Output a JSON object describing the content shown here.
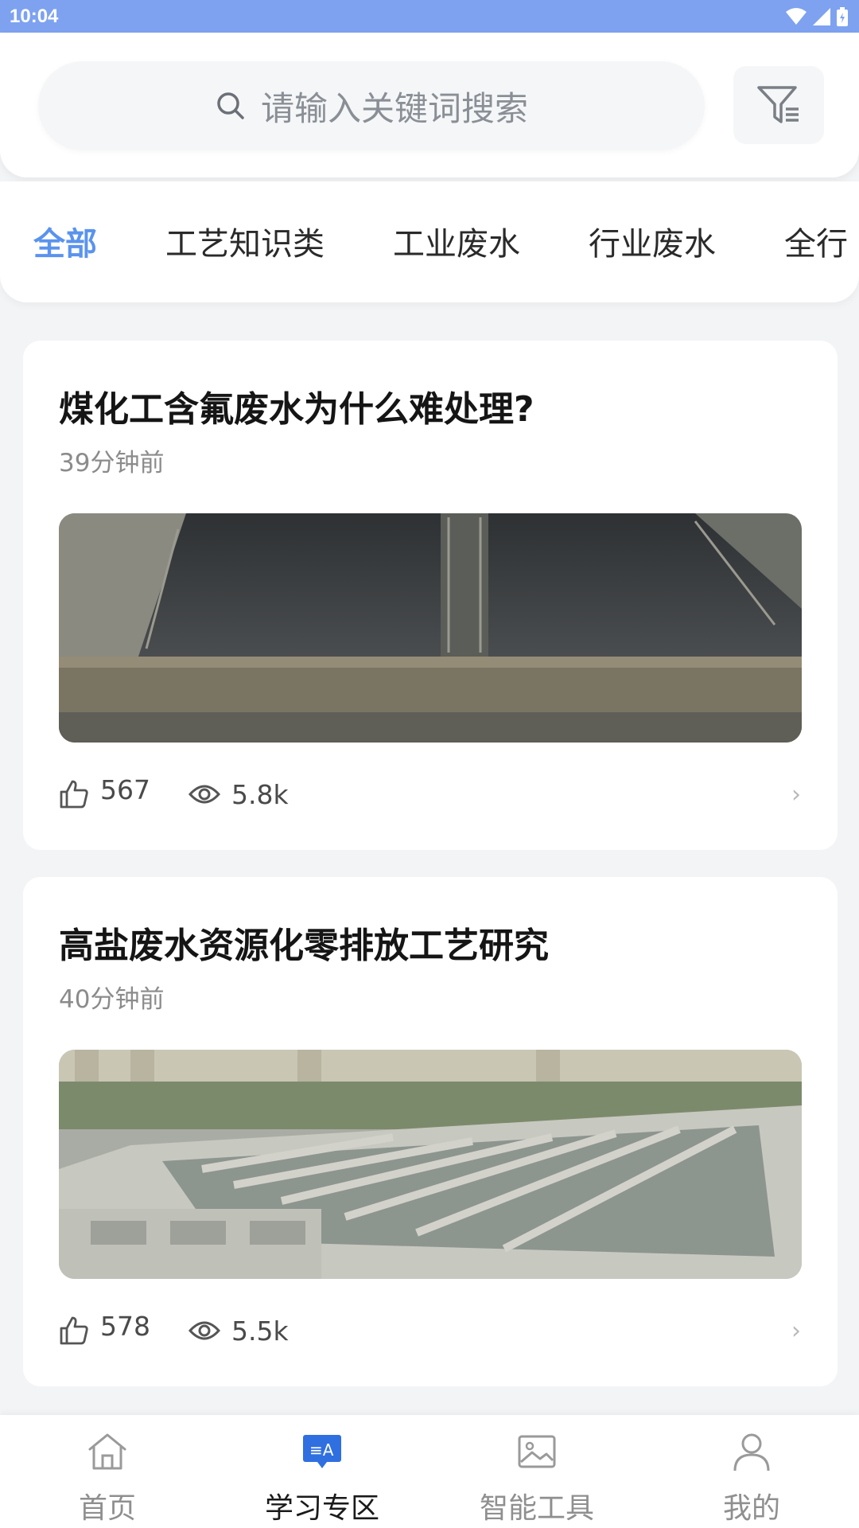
{
  "status_bar": {
    "time": "10:04"
  },
  "search": {
    "placeholder": "请输入关键词搜索"
  },
  "tabs": [
    {
      "label": "全部",
      "active": true
    },
    {
      "label": "工艺知识类"
    },
    {
      "label": "工业废水"
    },
    {
      "label": "行业废水"
    },
    {
      "label": "全行"
    }
  ],
  "articles": [
    {
      "title": "煤化工含氟废水为什么难处理?",
      "time": "39分钟前",
      "likes": "567",
      "views": "5.8k"
    },
    {
      "title": "高盐废水资源化零排放工艺研究",
      "time": "40分钟前",
      "likes": "578",
      "views": "5.5k"
    }
  ],
  "bottom_nav": [
    {
      "label": "首页",
      "icon": "home-icon"
    },
    {
      "label": "学习专区",
      "icon": "study-icon",
      "active": true
    },
    {
      "label": "智能工具",
      "icon": "image-icon"
    },
    {
      "label": "我的",
      "icon": "user-icon"
    }
  ],
  "colors": {
    "accent": "#5a93ee",
    "status_bar": "#7ea2f0"
  }
}
